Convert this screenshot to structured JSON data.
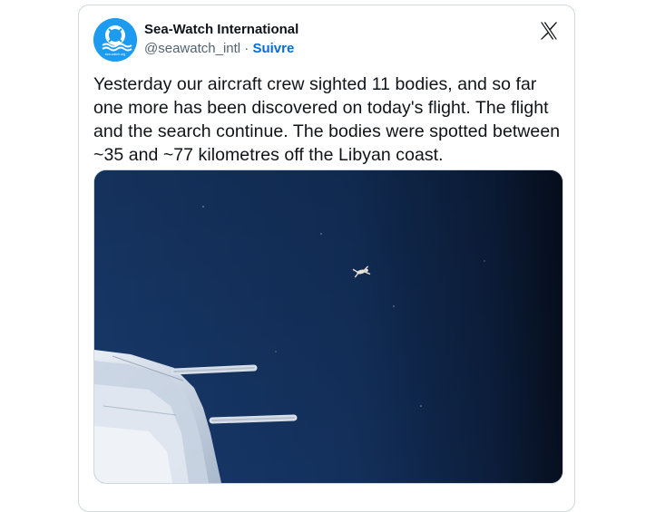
{
  "account": {
    "display_name": "Sea-Watch International",
    "handle": "@seawatch_intl",
    "separator": " · ",
    "follow_label": "Suivre",
    "avatar_text": "sea-watch.org"
  },
  "tweet": {
    "text": "Yesterday our aircraft crew sighted 11 bodies, and so far one more has been discovered on today's flight. The flight and the search continue. The bodies were spotted between ~35 and ~77 kilometres off the Libyan coast."
  },
  "icons": {
    "platform_logo": "x-logo-icon",
    "avatar_logo": "lifebuoy-wave-icon"
  },
  "colors": {
    "avatar_bg": "#1d9bf0",
    "follow_link": "#006fd6",
    "text_primary": "#0f1419",
    "text_secondary": "#536471",
    "sea_dark": "#0b1a33",
    "sea_mid": "#163566"
  }
}
